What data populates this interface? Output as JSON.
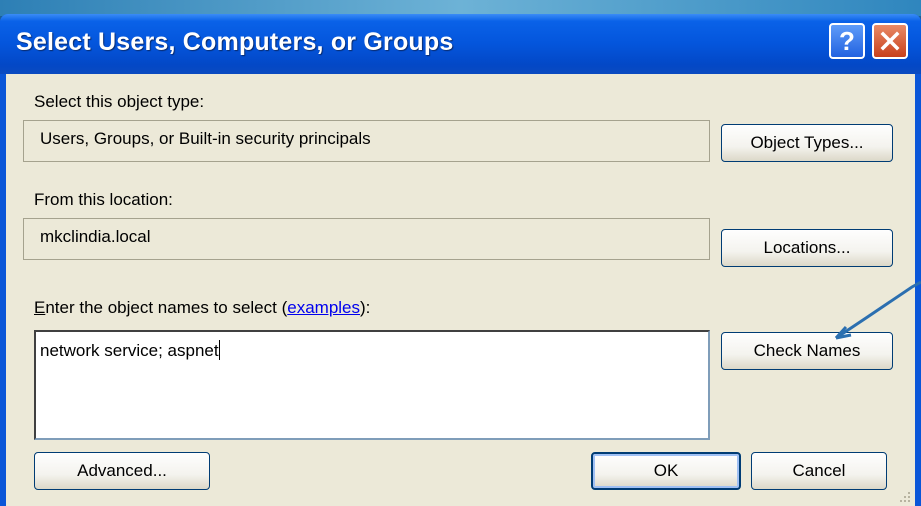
{
  "dialog": {
    "title": "Select Users, Computers, or Groups",
    "help_glyph": "?",
    "close_icon": "close-icon"
  },
  "object_type": {
    "label": "Select this object type:",
    "value": "Users, Groups, or Built-in security principals",
    "button": "Object Types..."
  },
  "location": {
    "label": "From this location:",
    "value": "mkclindia.local",
    "button": "Locations..."
  },
  "names": {
    "label_prefix_u": "E",
    "label_prefix_rest": "nter the object names to select (",
    "link": "examples",
    "label_suffix": "):",
    "value": "network service; aspnet",
    "check_button": "Check Names"
  },
  "footer": {
    "advanced": "Advanced...",
    "ok": "OK",
    "cancel": "Cancel"
  },
  "colors": {
    "titlebar": "#0455dc",
    "client": "#ece9d8",
    "link": "#0000ee",
    "callout_arrow": "#2b6fb0"
  }
}
